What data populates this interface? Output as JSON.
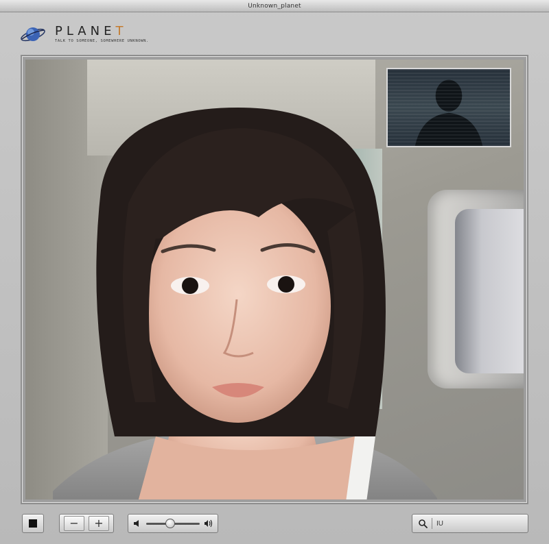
{
  "window": {
    "title": "Unknown_planet"
  },
  "brand": {
    "name_main": "PLANE",
    "name_accent": "T",
    "tagline": "TALK TO SOMEONE, SOMEWHERE UNKNOWN."
  },
  "controls": {
    "stop_icon": "stop-icon",
    "zoom_out_label": "−",
    "zoom_in_label": "+",
    "volume_level": 0.45
  },
  "search": {
    "value": "IU"
  },
  "colors": {
    "accent": "#c47a2c",
    "chrome": "#c9c9c9"
  }
}
